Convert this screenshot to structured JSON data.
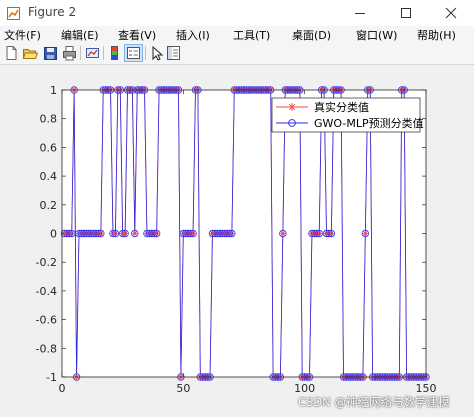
{
  "window": {
    "title": "Figure 2",
    "minimize_icon": "minimize-icon",
    "maximize_icon": "maximize-icon",
    "close_icon": "close-icon"
  },
  "menubar": {
    "items": [
      "文件(F)",
      "编辑(E)",
      "查看(V)",
      "插入(I)",
      "工具(T)",
      "桌面(D)",
      "窗口(W)",
      "帮助(H)"
    ]
  },
  "toolbar": {
    "icons": [
      "new-figure-icon",
      "open-file-icon",
      "save-icon",
      "print-icon",
      "link-plot-icon",
      "insert-colorbar-icon",
      "insert-legend-icon",
      "edit-plot-icon",
      "property-inspector-icon"
    ]
  },
  "colors": {
    "true_series": "#ff4444",
    "pred_series": "#2a2ae8",
    "marker_edge": "#3a3af0"
  },
  "chart_data": {
    "type": "line",
    "title": "",
    "xlabel": "",
    "ylabel": "",
    "xlim": [
      0,
      150
    ],
    "ylim": [
      -1,
      1
    ],
    "xticks": [
      "0",
      "50",
      "100",
      "150"
    ],
    "yticks": [
      "-1",
      "-0.8",
      "-0.6",
      "-0.4",
      "-0.2",
      "0",
      "0.2",
      "0.4",
      "0.6",
      "0.8",
      "1"
    ],
    "legend": {
      "location": "top-right",
      "entries": [
        "真实分类值",
        "GWO-MLP预测分类值"
      ]
    },
    "grid": false,
    "series": [
      {
        "name": "真实分类值",
        "marker": "asterisk",
        "values": [
          0,
          0,
          0,
          0,
          1,
          -1,
          0,
          0,
          0,
          0,
          0,
          0,
          0,
          0,
          0,
          0,
          1,
          1,
          1,
          1,
          0,
          0,
          1,
          1,
          0,
          0,
          1,
          1,
          1,
          0,
          1,
          1,
          1,
          1,
          0,
          0,
          0,
          0,
          0,
          1,
          1,
          1,
          1,
          1,
          1,
          1,
          1,
          1,
          -1,
          0,
          0,
          0,
          0,
          0,
          1,
          1,
          -1,
          -1,
          -1,
          -1,
          -1,
          0,
          0,
          0,
          0,
          0,
          0,
          0,
          0,
          0,
          1,
          1,
          1,
          1,
          1,
          1,
          1,
          1,
          1,
          1,
          1,
          1,
          1,
          1,
          1,
          1,
          -1,
          -1,
          -1,
          -1,
          0,
          1,
          1,
          1,
          1,
          1,
          1,
          1,
          -1,
          -1,
          -1,
          -1,
          0,
          0,
          0,
          0,
          1,
          1,
          0,
          0,
          0,
          1,
          1,
          1,
          1,
          -1,
          -1,
          -1,
          -1,
          -1,
          -1,
          -1,
          -1,
          -1,
          0,
          1,
          1,
          -1,
          -1,
          -1,
          -1,
          -1,
          -1,
          -1,
          -1,
          -1,
          -1,
          -1,
          -1,
          1,
          1,
          -1,
          -1,
          -1,
          -1,
          -1,
          -1,
          -1,
          -1,
          -1
        ]
      },
      {
        "name": "GWO-MLP预测分类值",
        "marker": "circle",
        "values": [
          0,
          0,
          0,
          0,
          1,
          -1,
          0,
          0,
          0,
          0,
          0,
          0,
          0,
          0,
          0,
          0,
          1,
          1,
          1,
          1,
          0,
          0,
          1,
          1,
          0,
          0,
          1,
          1,
          1,
          0,
          1,
          1,
          1,
          1,
          0,
          0,
          0,
          0,
          0,
          1,
          1,
          1,
          1,
          1,
          1,
          1,
          1,
          1,
          -1,
          0,
          0,
          0,
          0,
          0,
          1,
          1,
          -1,
          -1,
          -1,
          -1,
          -1,
          0,
          0,
          0,
          0,
          0,
          0,
          0,
          0,
          0,
          1,
          1,
          1,
          1,
          1,
          1,
          1,
          1,
          1,
          1,
          1,
          1,
          1,
          1,
          1,
          1,
          -1,
          -1,
          -1,
          -1,
          0,
          1,
          1,
          1,
          1,
          1,
          1,
          1,
          -1,
          -1,
          -1,
          -1,
          0,
          0,
          0,
          0,
          1,
          1,
          0,
          0,
          0,
          1,
          1,
          1,
          1,
          -1,
          -1,
          -1,
          -1,
          -1,
          -1,
          -1,
          -1,
          -1,
          0,
          1,
          1,
          -1,
          -1,
          -1,
          -1,
          -1,
          -1,
          -1,
          -1,
          -1,
          -1,
          -1,
          -1,
          1,
          1,
          -1,
          -1,
          -1,
          -1,
          -1,
          -1,
          -1,
          -1,
          -1
        ]
      }
    ]
  },
  "watermark": "CSDN @神经网络与数学建模"
}
